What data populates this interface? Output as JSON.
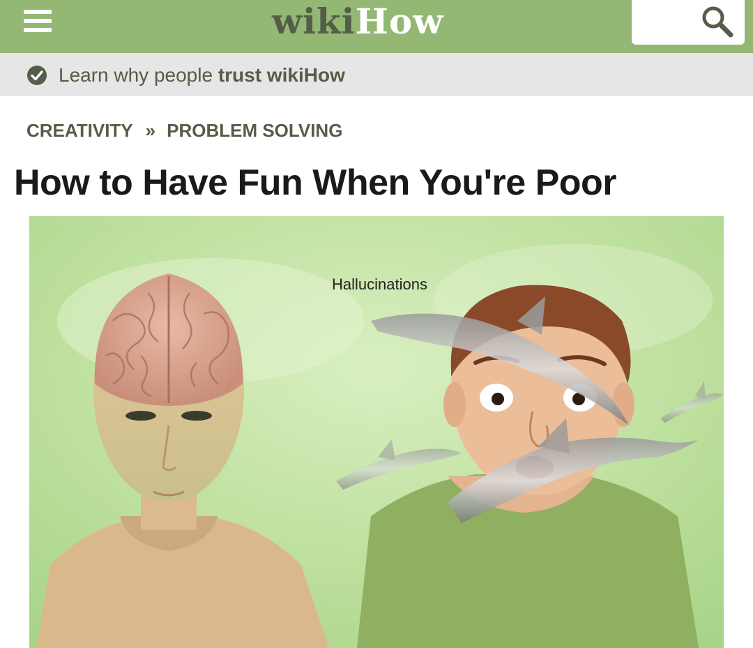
{
  "header": {
    "logo_wiki": "wiki",
    "logo_how": "How",
    "menu_icon": "hamburger-menu-icon",
    "search_icon": "search-icon",
    "accent_color": "#93b874"
  },
  "trust_bar": {
    "icon": "check-circle-icon",
    "text_prefix": "Learn why people ",
    "text_bold": "trust wikiHow"
  },
  "breadcrumb": {
    "items": [
      "CREATIVITY",
      "PROBLEM SOLVING"
    ],
    "separator": "»"
  },
  "article": {
    "title": "How to Have Fun When You're Poor",
    "image_caption": "Hallucinations"
  }
}
